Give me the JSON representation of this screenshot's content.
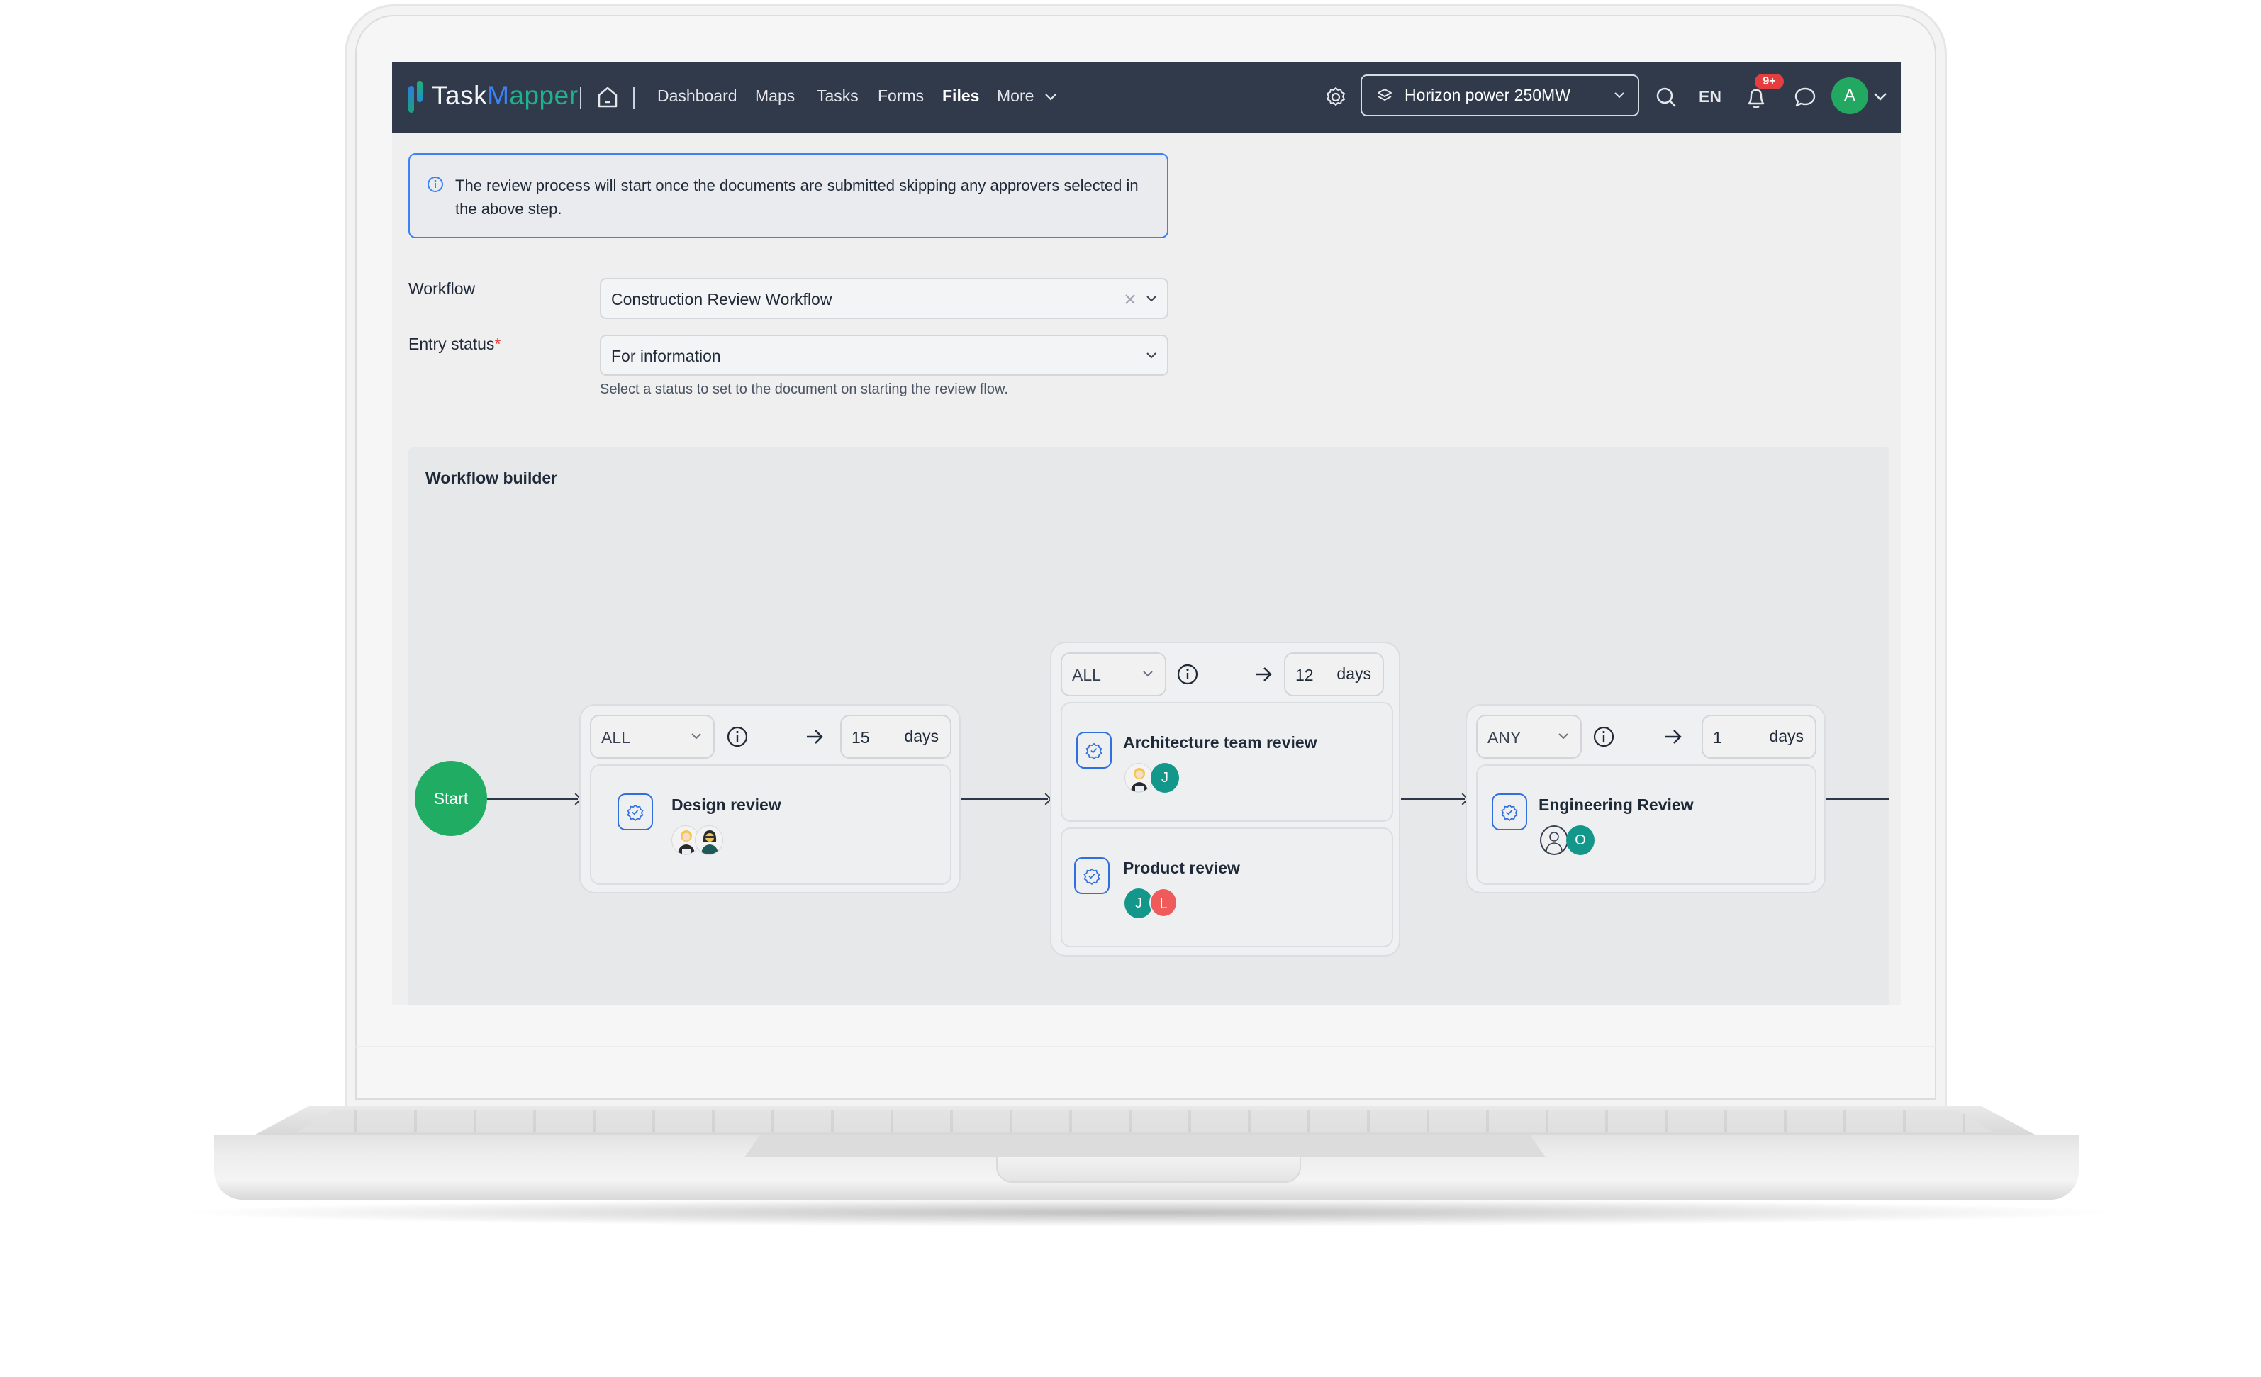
{
  "app": {
    "logo_part1": "Task",
    "logo_part2": "M",
    "logo_part3": "apper",
    "nav": [
      {
        "label": "Dashboard",
        "active": false
      },
      {
        "label": "Maps",
        "active": false
      },
      {
        "label": "Tasks",
        "active": false
      },
      {
        "label": "Forms",
        "active": false
      },
      {
        "label": "Files",
        "active": true
      },
      {
        "label": "More",
        "active": false
      }
    ],
    "project_selector": "Horizon power 250MW",
    "language": "EN",
    "notification_badge": "9+",
    "user_avatar_initial": "A",
    "icons": [
      "home-icon",
      "gear-icon",
      "layers-icon",
      "search-icon",
      "bell-icon",
      "chat-icon",
      "chevron-down-icon"
    ]
  },
  "colors": {
    "navbar_bg": "#303a4b",
    "accent_blue": "#3b82f6",
    "start_green": "#20ad63",
    "avatar_green": "#22a861",
    "teal_avatar": "#12978a",
    "red_avatar": "#ef5a5a",
    "badge_red": "#e53e3e"
  },
  "info": {
    "text": "The review process will start once the documents are submitted skipping any approvers selected in the above step."
  },
  "form": {
    "workflow_label": "Workflow",
    "workflow_value": "Construction Review Workflow",
    "entry_status_label": "Entry status",
    "required_mark": "*",
    "entry_status_value": "For information",
    "entry_status_helper": "Select a status to set to the document on starting the review flow."
  },
  "builder": {
    "title": "Workflow builder",
    "start_label": "Start",
    "steps": [
      {
        "condition": "ALL",
        "duration": "15",
        "duration_unit": "days",
        "reviews": [
          {
            "title": "Design review",
            "assignees": [
              {
                "type": "image",
                "desc": "woman-blonde"
              },
              {
                "type": "image",
                "desc": "woman-glasses"
              }
            ]
          }
        ]
      },
      {
        "condition": "ALL",
        "duration": "12",
        "duration_unit": "days",
        "reviews": [
          {
            "title": "Architecture team review",
            "assignees": [
              {
                "type": "image",
                "desc": "woman-blonde"
              },
              {
                "type": "initial",
                "initial": "J",
                "color": "teal"
              }
            ]
          },
          {
            "title": "Product review",
            "assignees": [
              {
                "type": "initial",
                "initial": "J",
                "color": "teal"
              },
              {
                "type": "initial",
                "initial": "L",
                "color": "red"
              }
            ]
          }
        ]
      },
      {
        "condition": "ANY",
        "duration": "1",
        "duration_unit": "days",
        "reviews": [
          {
            "title": "Engineering Review",
            "assignees": [
              {
                "type": "image",
                "desc": "person-outline"
              },
              {
                "type": "initial",
                "initial": "O",
                "color": "teal"
              }
            ]
          }
        ]
      }
    ]
  }
}
